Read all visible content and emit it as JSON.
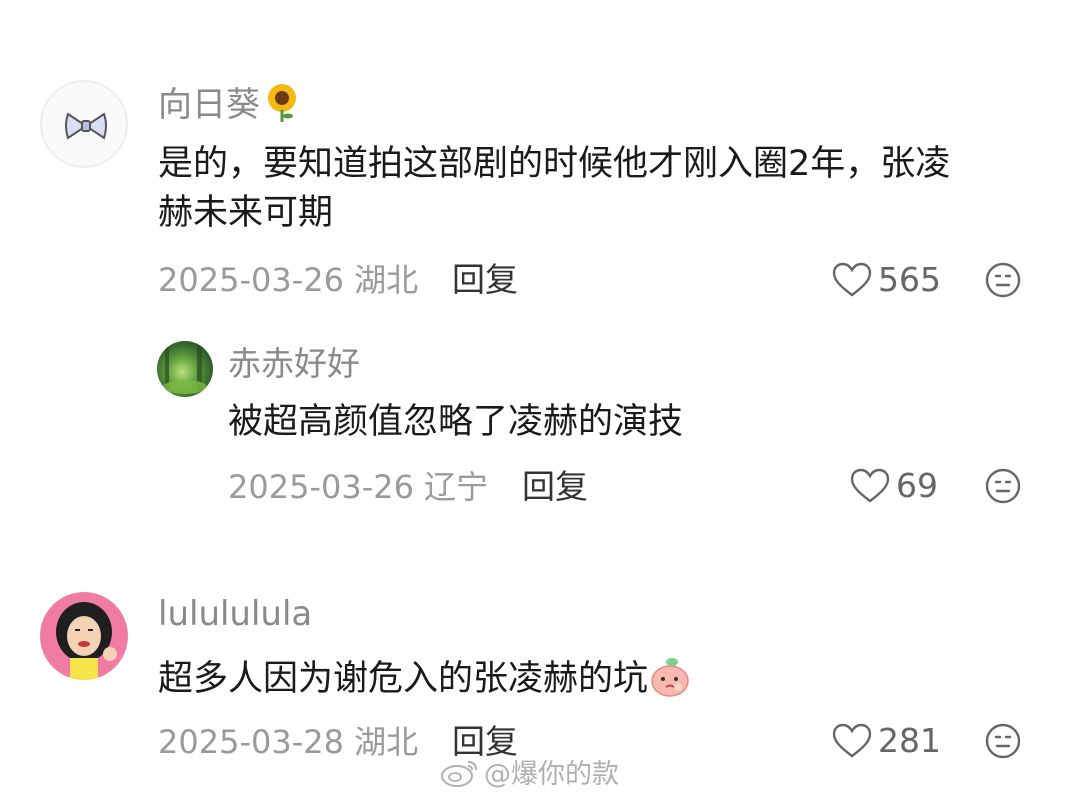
{
  "comments": [
    {
      "username": "向日葵",
      "username_emoji": "sunflower-emoji",
      "text_line1": "是的，要知道拍这部剧的时候他才刚入圈2年，张凌",
      "text_line2": "赫未来可期",
      "date": "2025-03-26",
      "location": "湖北",
      "reply_label": "回复",
      "likes": "565",
      "replies": [
        {
          "username": "赤赤好好",
          "text": "被超高颜值忽略了凌赫的演技",
          "date": "2025-03-26",
          "location": "辽宁",
          "reply_label": "回复",
          "likes": "69"
        }
      ]
    },
    {
      "username": "lulululula",
      "text": "超多人因为谢危入的张凌赫的坑",
      "text_emoji": "peach-emoji",
      "date": "2025-03-28",
      "location": "湖北",
      "reply_label": "回复",
      "likes": "281"
    }
  ],
  "watermark": "@爆你的款",
  "colors": {
    "meta": "#9a9a9a",
    "username": "#8a8a8a",
    "text": "#1a1a1a"
  }
}
